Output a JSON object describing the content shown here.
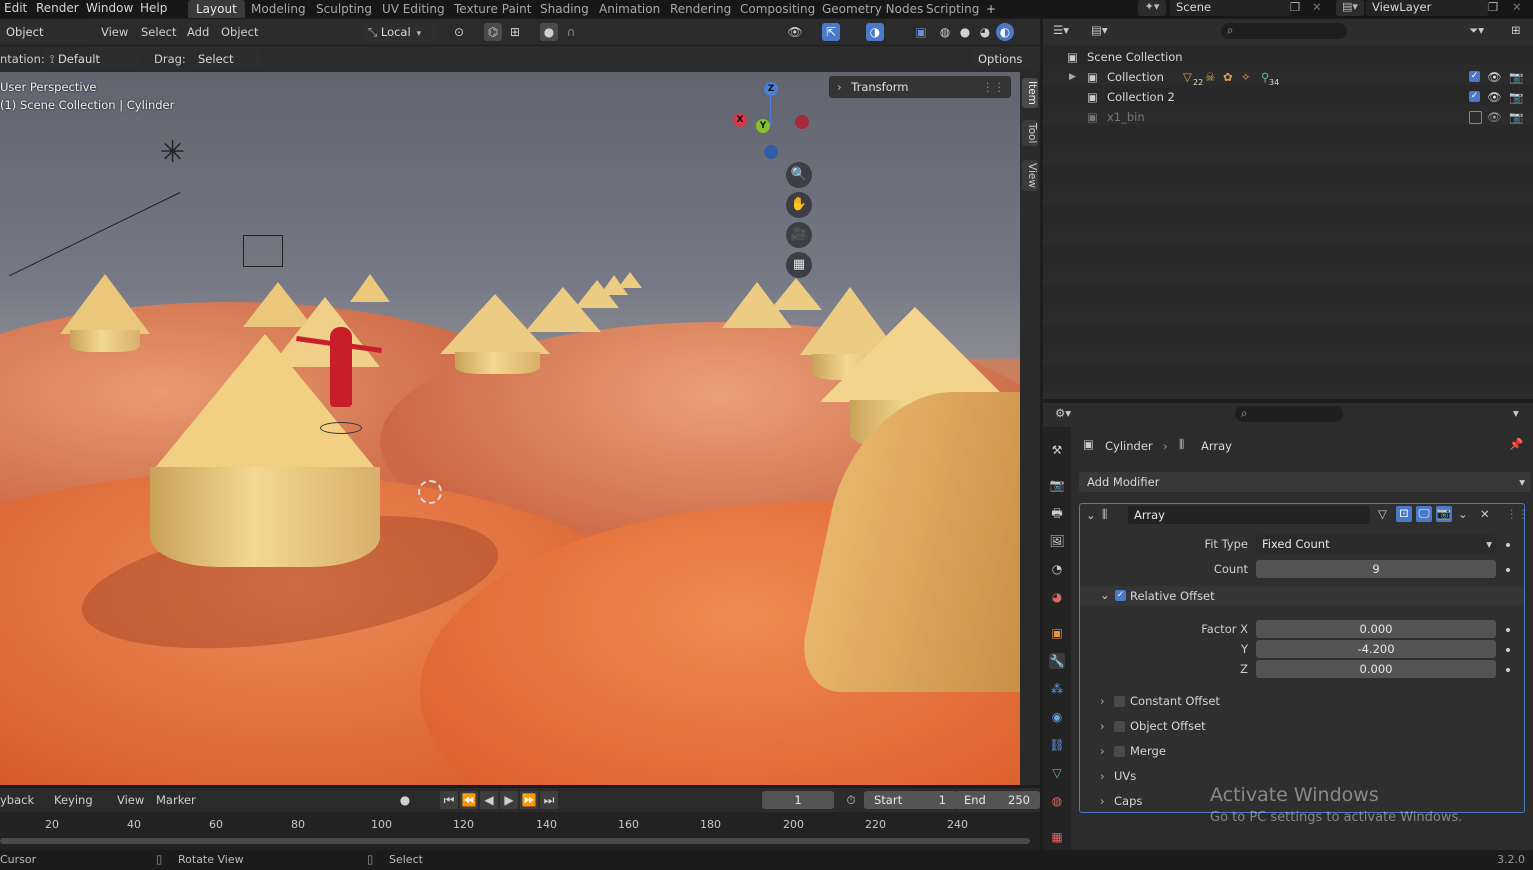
{
  "top_menu": [
    "Edit",
    "Render",
    "Window",
    "Help"
  ],
  "workspaces": [
    "Layout",
    "Modeling",
    "Sculpting",
    "UV Editing",
    "Texture Paint",
    "Shading",
    "Animation",
    "Rendering",
    "Compositing",
    "Geometry Nodes",
    "Scripting"
  ],
  "active_workspace": "Layout",
  "add_workspace_symbol": "+",
  "scene": {
    "label": "Scene",
    "view_layer": "ViewLayer"
  },
  "viewport_header": {
    "mode": "Object Mode",
    "menus": [
      "View",
      "Select",
      "Add",
      "Object"
    ],
    "transform_space": "Local"
  },
  "viewport_subheader": {
    "orientation_label": "ntation:",
    "orientation_value": "Default",
    "drag_label": "Drag:",
    "drag_value": "Select Box",
    "options_label": "Options"
  },
  "viewport": {
    "perspective": "User Perspective",
    "context": "(1) Scene Collection | Cylinder",
    "transform_panel": "Transform",
    "npanel_tabs": [
      "Item",
      "Tool",
      "View"
    ],
    "gizmo": {
      "x": "X",
      "y": "Y",
      "z": "Z"
    }
  },
  "outliner": {
    "root": "Scene Collection",
    "items": [
      {
        "name": "Collection",
        "badges": [
          "22",
          "34"
        ]
      },
      {
        "name": "Collection 2"
      },
      {
        "name": "x1_bin"
      }
    ]
  },
  "properties": {
    "breadcrumb_object": "Cylinder",
    "breadcrumb_modifier": "Array",
    "add_modifier": "Add Modifier",
    "modifier_name": "Array",
    "fit_type_label": "Fit Type",
    "fit_type_value": "Fixed Count",
    "count_label": "Count",
    "count_value": "9",
    "relative_offset_label": "Relative Offset",
    "factor_x_label": "Factor X",
    "factor_x_value": "0.000",
    "y_label": "Y",
    "y_value": "-4.200",
    "z_label": "Z",
    "z_value": "0.000",
    "subpanels": [
      "Constant Offset",
      "Object Offset",
      "Merge",
      "UVs",
      "Caps"
    ]
  },
  "timeline": {
    "menus": [
      "yback",
      "Keying",
      "View",
      "Marker"
    ],
    "current_frame": "1",
    "start_label": "Start",
    "start_value": "1",
    "end_label": "End",
    "end_value": "250",
    "ticks": [
      "20",
      "40",
      "60",
      "80",
      "100",
      "120",
      "140",
      "160",
      "180",
      "200",
      "220",
      "240"
    ]
  },
  "statusbar": {
    "left": "Cursor",
    "middle": "Rotate View",
    "right": "Select",
    "version": "3.2.0"
  },
  "watermark": {
    "line1": "Activate Windows",
    "line2": "Go to PC settings to activate Windows."
  }
}
